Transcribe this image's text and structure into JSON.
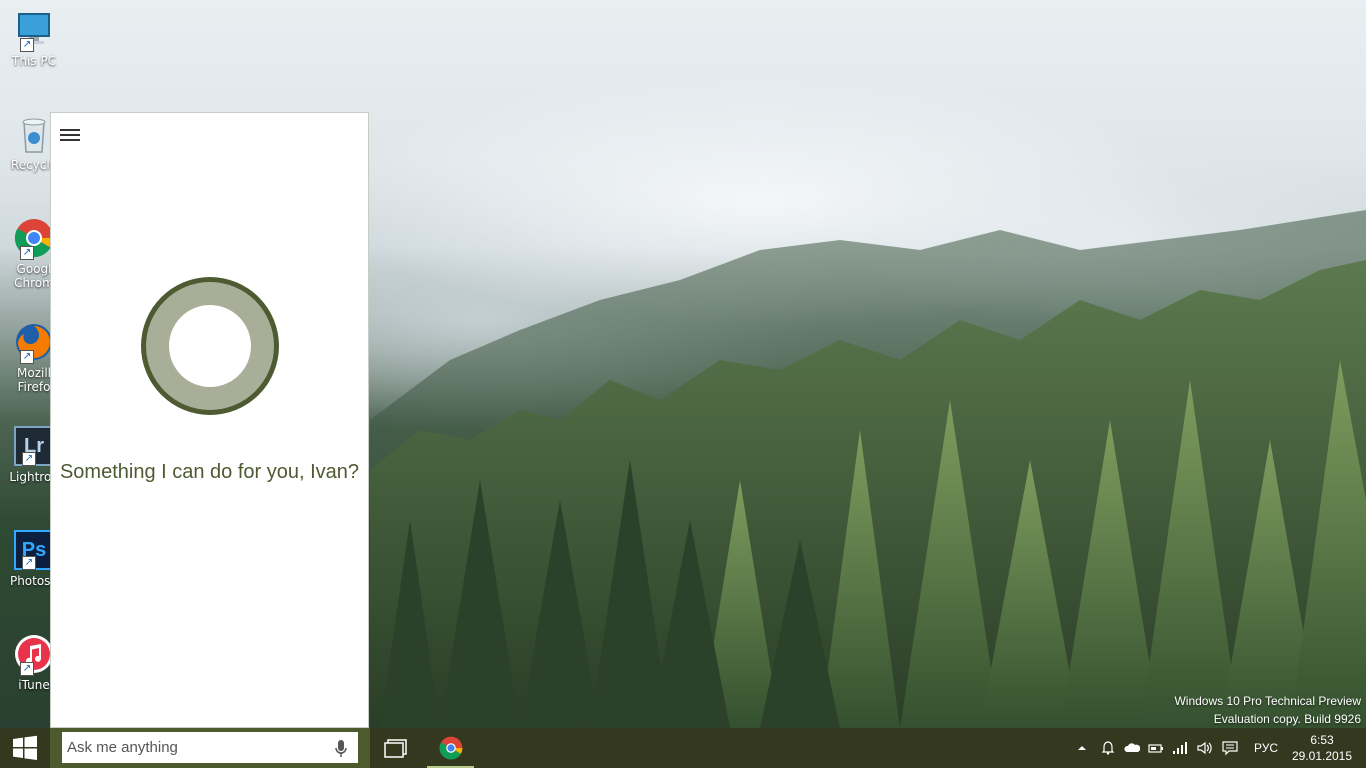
{
  "desktop": {
    "icons": [
      {
        "label": "This PC",
        "icon": "computer-icon"
      },
      {
        "label": "Recycle",
        "icon": "recycle-bin-icon"
      },
      {
        "label": "Googl",
        "label2": "Chrom",
        "icon": "chrome-icon"
      },
      {
        "label": "Mozill",
        "label2": "Firefo",
        "icon": "firefox-icon"
      },
      {
        "label": "Lightroo",
        "icon": "lightroom-icon",
        "glyph": "Lr"
      },
      {
        "label": "Photosh",
        "icon": "photoshop-icon",
        "glyph": "Ps"
      },
      {
        "label": "iTune",
        "icon": "itunes-icon"
      }
    ],
    "watermark": {
      "line1": "Windows 10 Pro Technical Preview",
      "line2": "Evaluation copy. Build 9926"
    }
  },
  "cortana": {
    "greeting": "Something I can do for you, Ivan?",
    "colors": {
      "ring_outer": "#4e5a32",
      "ring_inner": "#a9ae98",
      "greeting_text": "#4e5a32"
    }
  },
  "taskbar": {
    "search": {
      "placeholder": "Ask me anything"
    },
    "tray": {
      "language": "РУС",
      "time": "6:53",
      "date": "29.01.2015"
    },
    "colors": {
      "background": "#33381f",
      "search_bg": "#4c5a2d"
    }
  }
}
